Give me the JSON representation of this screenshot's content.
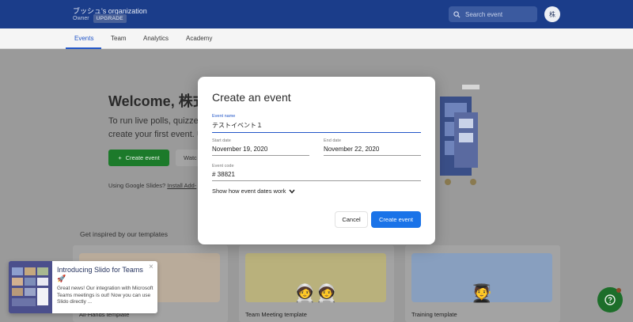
{
  "header": {
    "org_name": "ブッシュ's organization",
    "role": "Owner",
    "upgrade_label": "UPGRADE",
    "search_placeholder": "Search event",
    "avatar_initial": "株"
  },
  "tabs": [
    {
      "label": "Events",
      "active": true
    },
    {
      "label": "Team",
      "active": false
    },
    {
      "label": "Analytics",
      "active": false
    },
    {
      "label": "Academy",
      "active": false
    }
  ],
  "background": {
    "welcome": "Welcome, 株式会",
    "intro_line1": "To run live polls, quizzes o",
    "intro_line2": "create your first event. Un",
    "create_event_label": "Create event",
    "watch_label": "Watc",
    "google_slides_text": "Using Google Slides?",
    "google_slides_link": "Install Add-",
    "inspired_title": "Get inspired by our templates",
    "templates": [
      {
        "title": "All-Hands template",
        "color": "#e8c2a0"
      },
      {
        "title": "Team Meeting template",
        "color": "#e3cf6e"
      },
      {
        "title": "Training template",
        "color": "#7fa8e8"
      }
    ]
  },
  "modal": {
    "title": "Create an event",
    "event_name_label": "Event name",
    "event_name_value": "テストイベント１",
    "start_date_label": "Start date",
    "start_date_value": "November 19, 2020",
    "end_date_label": "End date",
    "end_date_value": "November 22, 2020",
    "event_code_label": "Event code",
    "event_code_value": "# 38821",
    "dates_link": "Show how event dates work",
    "cancel_label": "Cancel",
    "create_label": "Create event"
  },
  "toast": {
    "title": "Introducing Slido for Teams 🚀",
    "body": "Great news! Our integration with Microsoft Teams meetings is out! Now you can use Slido directly ..."
  },
  "colors": {
    "header": "#1b3d8a",
    "primary": "#1a73e8",
    "green": "#1c7a2a"
  }
}
